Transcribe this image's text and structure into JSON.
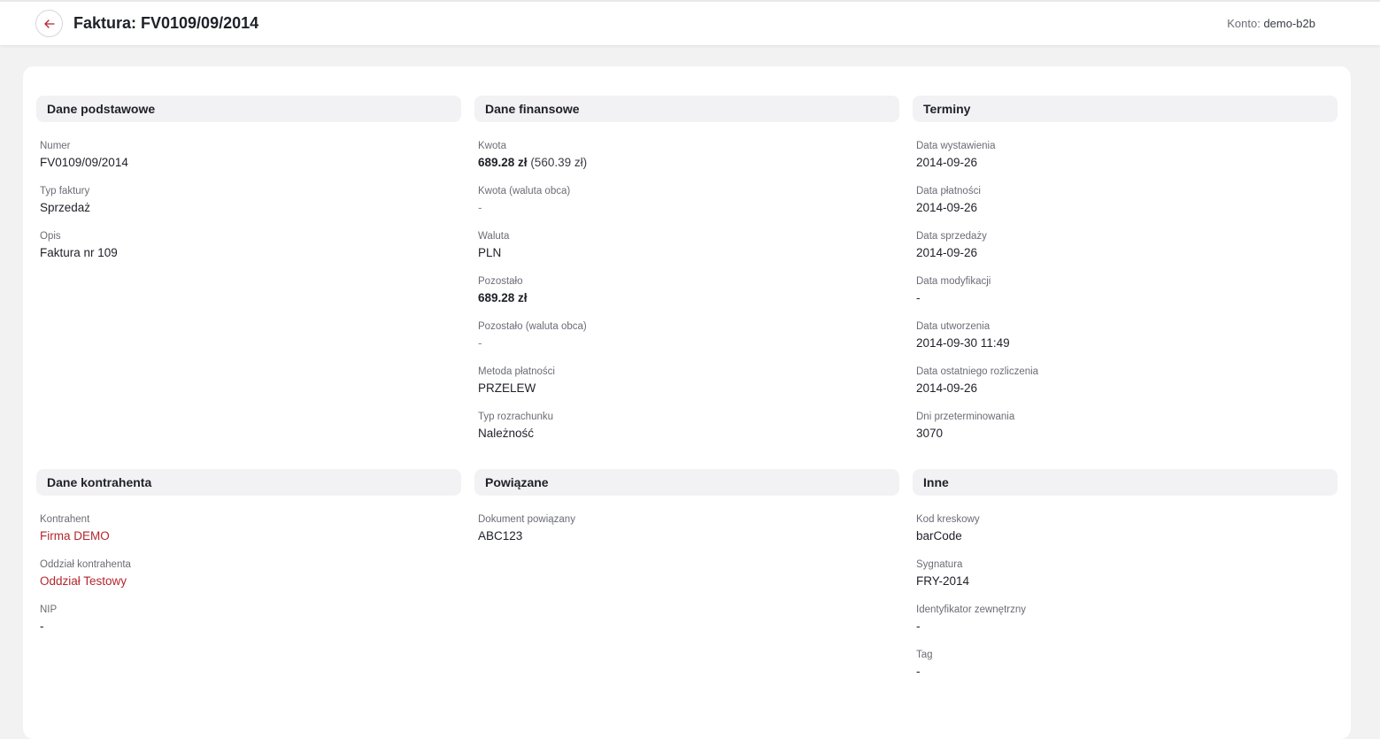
{
  "header": {
    "title": "Faktura: FV0109/09/2014",
    "account_label": "Konto:",
    "account_value": "demo-b2b"
  },
  "sections": {
    "basic": {
      "title": "Dane podstawowe",
      "fields": [
        {
          "label": "Numer",
          "value": "FV0109/09/2014"
        },
        {
          "label": "Typ faktury",
          "value": "Sprzedaż"
        },
        {
          "label": "Opis",
          "value": "Faktura nr 109"
        }
      ]
    },
    "finance": {
      "title": "Dane finansowe",
      "amount_label": "Kwota",
      "amount_value": "689.28 zł",
      "amount_net": "(560.39 zł)",
      "fields": [
        {
          "label": "Kwota (waluta obca)",
          "value": "-"
        },
        {
          "label": "Waluta",
          "value": "PLN"
        },
        {
          "label": "Pozostało",
          "value": "689.28 zł"
        },
        {
          "label": "Pozostało (waluta obca)",
          "value": "-"
        },
        {
          "label": "Metoda płatności",
          "value": "PRZELEW"
        },
        {
          "label": "Typ rozrachunku",
          "value": "Należność"
        }
      ]
    },
    "dates": {
      "title": "Terminy",
      "fields": [
        {
          "label": "Data wystawienia",
          "value": "2014-09-26"
        },
        {
          "label": "Data płatności",
          "value": "2014-09-26"
        },
        {
          "label": "Data sprzedaży",
          "value": "2014-09-26"
        },
        {
          "label": "Data modyfikacji",
          "value": "-"
        },
        {
          "label": "Data utworzenia",
          "value": "2014-09-30 11:49"
        },
        {
          "label": "Data ostatniego rozliczenia",
          "value": "2014-09-26"
        },
        {
          "label": "Dni przeterminowania",
          "value": "3070"
        }
      ]
    },
    "contractor": {
      "title": "Dane kontrahenta",
      "fields": [
        {
          "label": "Kontrahent",
          "value": "Firma DEMO"
        },
        {
          "label": "Oddział kontrahenta",
          "value": "Oddział Testowy"
        },
        {
          "label": "NIP",
          "value": "-"
        }
      ]
    },
    "related": {
      "title": "Powiązane",
      "fields": [
        {
          "label": "Dokument powiązany",
          "value": "ABC123"
        }
      ]
    },
    "other": {
      "title": "Inne",
      "fields": [
        {
          "label": "Kod kreskowy",
          "value": "barCode"
        },
        {
          "label": "Sygnatura",
          "value": "FRY-2014"
        },
        {
          "label": "Identyfikator zewnętrzny",
          "value": "-"
        },
        {
          "label": "Tag",
          "value": "-"
        }
      ]
    }
  },
  "colors": {
    "accent": "#b3262e",
    "background": "#f2f2f3",
    "section_header_bg": "#f2f2f4"
  },
  "icons": {
    "back": "arrow-left-icon"
  }
}
